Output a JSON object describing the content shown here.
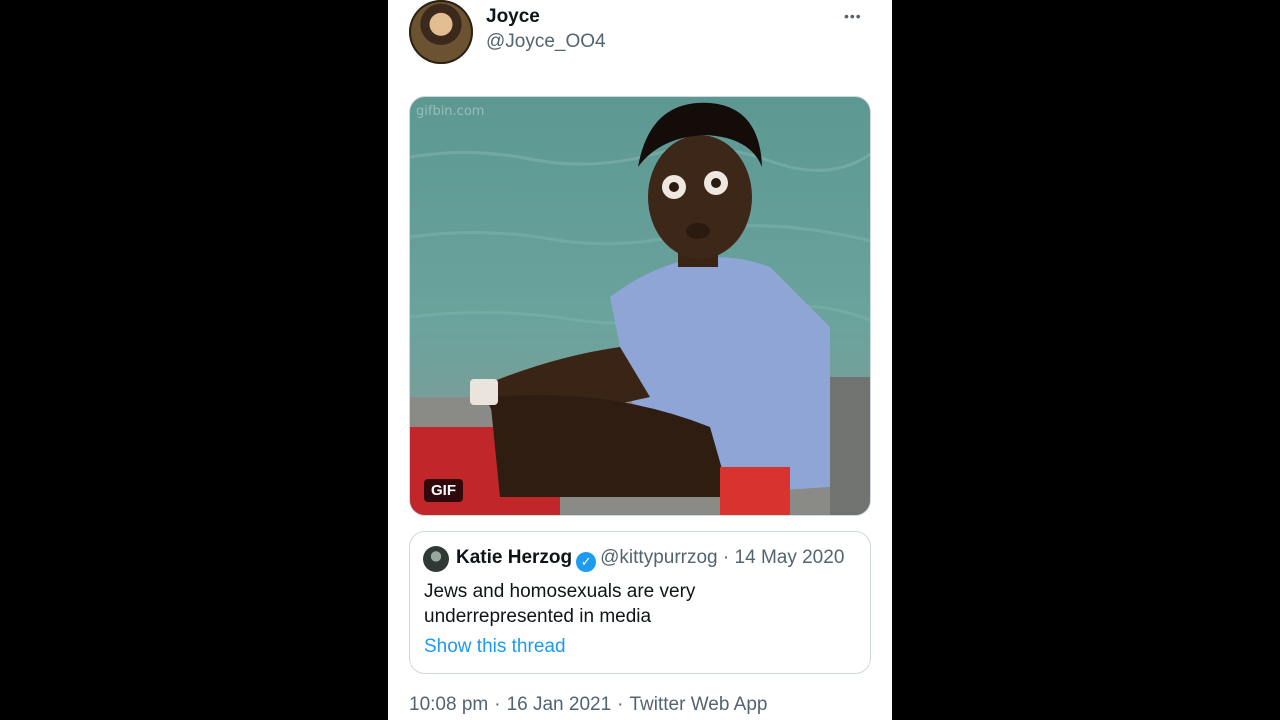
{
  "tweet": {
    "author_name": "Joyce",
    "author_handle": "@Joyce_OO4",
    "more_icon": "•••",
    "media": {
      "badge": "GIF",
      "watermark": "gifbin.com"
    },
    "quoted": {
      "author_name": "Katie Herzog",
      "verified_icon": "✓",
      "author_handle": "@kittypurrzog",
      "separator": "·",
      "date": "14 May 2020",
      "text": "Jews and homosexuals are very underrepresented in media",
      "link": "Show this thread"
    },
    "time": "10:08 pm",
    "date": "16 Jan 2021",
    "source": "Twitter Web App",
    "separator": "·"
  },
  "colors": {
    "link": "#1d9bf0",
    "secondary_text": "#536471",
    "primary_text": "#0f1419",
    "side_background": "#000000"
  }
}
